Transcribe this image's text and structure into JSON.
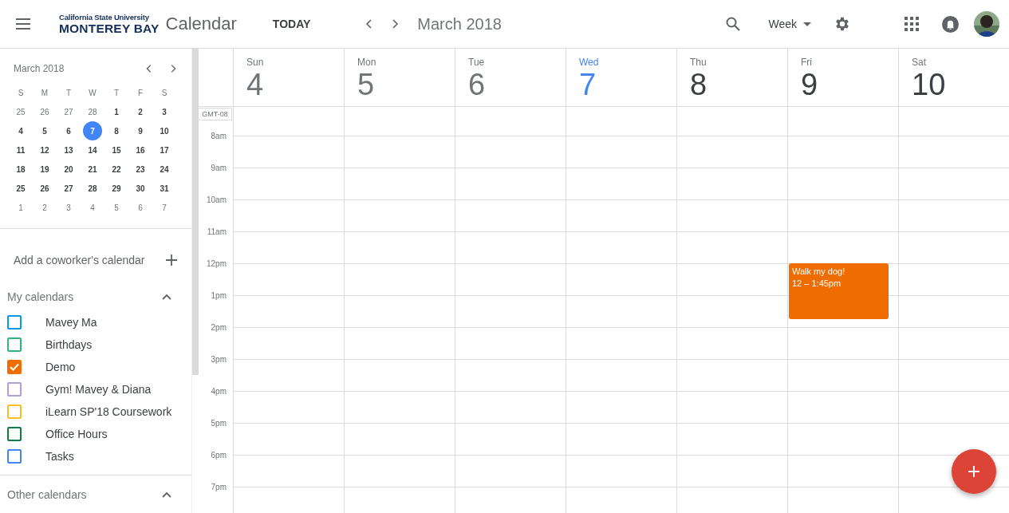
{
  "header": {
    "logo_top": "California State University",
    "logo_bottom": "MONTEREY BAY",
    "app_name": "Calendar",
    "today_button": "TODAY",
    "range": "March 2018",
    "view_select": "Week"
  },
  "mini_calendar": {
    "title": "March 2018",
    "weekdays": [
      "S",
      "M",
      "T",
      "W",
      "T",
      "F",
      "S"
    ],
    "weeks": [
      [
        {
          "day": "25",
          "dim": true,
          "selected": false
        },
        {
          "day": "26",
          "dim": true,
          "selected": false
        },
        {
          "day": "27",
          "dim": true,
          "selected": false
        },
        {
          "day": "28",
          "dim": true,
          "selected": false
        },
        {
          "day": "1",
          "dim": false,
          "selected": false
        },
        {
          "day": "2",
          "dim": false,
          "selected": false
        },
        {
          "day": "3",
          "dim": false,
          "selected": false
        }
      ],
      [
        {
          "day": "4",
          "dim": false,
          "selected": false
        },
        {
          "day": "5",
          "dim": false,
          "selected": false
        },
        {
          "day": "6",
          "dim": false,
          "selected": false
        },
        {
          "day": "7",
          "dim": false,
          "selected": true
        },
        {
          "day": "8",
          "dim": false,
          "selected": false
        },
        {
          "day": "9",
          "dim": false,
          "selected": false
        },
        {
          "day": "10",
          "dim": false,
          "selected": false
        }
      ],
      [
        {
          "day": "11",
          "dim": false,
          "selected": false
        },
        {
          "day": "12",
          "dim": false,
          "selected": false
        },
        {
          "day": "13",
          "dim": false,
          "selected": false
        },
        {
          "day": "14",
          "dim": false,
          "selected": false
        },
        {
          "day": "15",
          "dim": false,
          "selected": false
        },
        {
          "day": "16",
          "dim": false,
          "selected": false
        },
        {
          "day": "17",
          "dim": false,
          "selected": false
        }
      ],
      [
        {
          "day": "18",
          "dim": false,
          "selected": false
        },
        {
          "day": "19",
          "dim": false,
          "selected": false
        },
        {
          "day": "20",
          "dim": false,
          "selected": false
        },
        {
          "day": "21",
          "dim": false,
          "selected": false
        },
        {
          "day": "22",
          "dim": false,
          "selected": false
        },
        {
          "day": "23",
          "dim": false,
          "selected": false
        },
        {
          "day": "24",
          "dim": false,
          "selected": false
        }
      ],
      [
        {
          "day": "25",
          "dim": false,
          "selected": false
        },
        {
          "day": "26",
          "dim": false,
          "selected": false
        },
        {
          "day": "27",
          "dim": false,
          "selected": false
        },
        {
          "day": "28",
          "dim": false,
          "selected": false
        },
        {
          "day": "29",
          "dim": false,
          "selected": false
        },
        {
          "day": "30",
          "dim": false,
          "selected": false
        },
        {
          "day": "31",
          "dim": false,
          "selected": false
        }
      ],
      [
        {
          "day": "1",
          "dim": true,
          "selected": false
        },
        {
          "day": "2",
          "dim": true,
          "selected": false
        },
        {
          "day": "3",
          "dim": true,
          "selected": false
        },
        {
          "day": "4",
          "dim": true,
          "selected": false
        },
        {
          "day": "5",
          "dim": true,
          "selected": false
        },
        {
          "day": "6",
          "dim": true,
          "selected": false
        },
        {
          "day": "7",
          "dim": true,
          "selected": false
        }
      ]
    ]
  },
  "add_calendar": {
    "label": "Add a coworker's calendar"
  },
  "my_calendars": {
    "title": "My calendars",
    "expanded": true,
    "items": [
      {
        "name": "Mavey Ma",
        "color": "#039be5",
        "checked": false
      },
      {
        "name": "Birthdays",
        "color": "#33b679",
        "checked": false
      },
      {
        "name": "Demo",
        "color": "#ef6c00",
        "checked": true
      },
      {
        "name": "Gym! Mavey & Diana",
        "color": "#b39ddb",
        "checked": false
      },
      {
        "name": "iLearn SP'18 Coursework",
        "color": "#f6bf26",
        "checked": false
      },
      {
        "name": "Office Hours",
        "color": "#0b8043",
        "checked": false
      },
      {
        "name": "Tasks",
        "color": "#4285f4",
        "checked": false
      }
    ]
  },
  "other_calendars": {
    "title": "Other calendars",
    "expanded": true
  },
  "week": {
    "timezone": "GMT-08",
    "days": [
      {
        "name": "Sun",
        "date": "4",
        "today": false,
        "past": true
      },
      {
        "name": "Mon",
        "date": "5",
        "today": false,
        "past": true
      },
      {
        "name": "Tue",
        "date": "6",
        "today": false,
        "past": true
      },
      {
        "name": "Wed",
        "date": "7",
        "today": true,
        "past": false
      },
      {
        "name": "Thu",
        "date": "8",
        "today": false,
        "past": false
      },
      {
        "name": "Fri",
        "date": "9",
        "today": false,
        "past": false,
        "events": [
          {
            "title": "Walk my dog!",
            "time": "12 – 1:45pm",
            "color": "#ef6c00"
          }
        ]
      },
      {
        "name": "Sat",
        "date": "10",
        "today": false,
        "past": false
      }
    ],
    "hours": [
      "8am",
      "9am",
      "10am",
      "11am",
      "12pm",
      "1pm",
      "2pm",
      "3pm",
      "4pm",
      "5pm",
      "6pm",
      "7pm"
    ]
  }
}
